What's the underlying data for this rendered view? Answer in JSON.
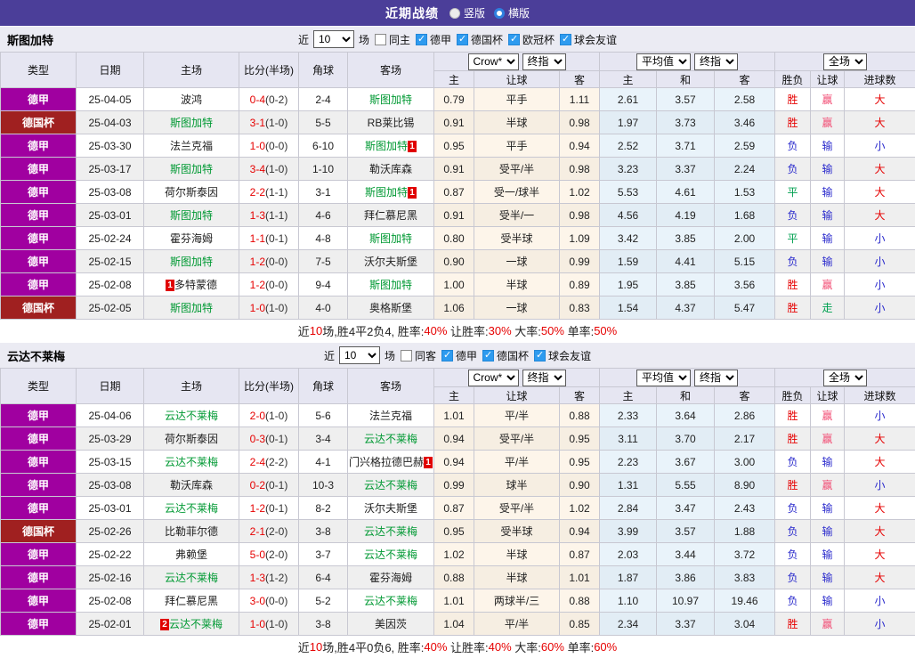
{
  "title_bar": {
    "title": "近期战绩",
    "radios": [
      {
        "label": "竖版",
        "selected": true
      },
      {
        "label": "横版",
        "selected": false
      }
    ]
  },
  "colors": {
    "title_bg": "#4B3E99",
    "team_highlight": "#009933",
    "score_red": "#E60000",
    "result_win_red": "#E60000",
    "result_cover_pink": "#F24D74",
    "result_lose_blue": "#2929CC",
    "result_draw_green": "#00A050",
    "handicap_col_bg": "#FDF5EA",
    "average_col_bg": "#E9F3FA",
    "header_bg": "#E6E6F2",
    "rank_badge_bg": "#E00000"
  },
  "league_colors": {
    "德甲": "#A000A0",
    "德国杯": "#A02020"
  },
  "table_header": {
    "main_cols": [
      "类型",
      "日期",
      "主场",
      "比分(半场)",
      "角球",
      "客场"
    ],
    "sub_cols": [
      "主",
      "让球",
      "客",
      "主",
      "和",
      "客",
      "胜负",
      "让球",
      "进球数"
    ],
    "selects": {
      "bookmaker": "Crow*",
      "odds_type_1": "终指",
      "average": "平均值",
      "odds_type_2": "终指",
      "scope": "全场"
    }
  },
  "sections": [
    {
      "team": "斯图加特",
      "filter": {
        "recent_label": "近",
        "count": "10",
        "matches_label": "场",
        "same_label": "同主",
        "same_checked": false,
        "leagues": [
          {
            "label": "德甲",
            "checked": true
          },
          {
            "label": "德国杯",
            "checked": true
          },
          {
            "label": "欧冠杯",
            "checked": true
          },
          {
            "label": "球会友谊",
            "checked": true
          }
        ]
      },
      "rows": [
        {
          "league": "德甲",
          "date": "25-04-05",
          "home": {
            "name": "波鸿"
          },
          "ft": "0-4",
          "ht": "0-2",
          "corner": "2-4",
          "away": {
            "name": "斯图加特",
            "green": true
          },
          "handicap": [
            "0.79",
            "平手",
            "1.11"
          ],
          "avg": [
            "2.61",
            "3.57",
            "2.58"
          ],
          "results": [
            [
              "胜",
              "r"
            ],
            [
              "赢",
              "p"
            ],
            [
              "大",
              "r"
            ]
          ]
        },
        {
          "league": "德国杯",
          "date": "25-04-03",
          "home": {
            "name": "斯图加特",
            "green": true
          },
          "ft": "3-1",
          "ht": "1-0",
          "corner": "5-5",
          "away": {
            "name": "RB莱比锡"
          },
          "handicap": [
            "0.91",
            "半球",
            "0.98"
          ],
          "avg": [
            "1.97",
            "3.73",
            "3.46"
          ],
          "results": [
            [
              "胜",
              "r"
            ],
            [
              "赢",
              "p"
            ],
            [
              "大",
              "r"
            ]
          ]
        },
        {
          "league": "德甲",
          "date": "25-03-30",
          "home": {
            "name": "法兰克福"
          },
          "ft": "1-0",
          "ht": "0-0",
          "corner": "6-10",
          "away": {
            "name": "斯图加特",
            "green": true,
            "rank": "1",
            "rank_pos": "after"
          },
          "handicap": [
            "0.95",
            "平手",
            "0.94"
          ],
          "avg": [
            "2.52",
            "3.71",
            "2.59"
          ],
          "results": [
            [
              "负",
              "b"
            ],
            [
              "输",
              "b"
            ],
            [
              "小",
              "b"
            ]
          ]
        },
        {
          "league": "德甲",
          "date": "25-03-17",
          "home": {
            "name": "斯图加特",
            "green": true
          },
          "ft": "3-4",
          "ht": "1-0",
          "corner": "1-10",
          "away": {
            "name": "勒沃库森"
          },
          "handicap": [
            "0.91",
            "受平/半",
            "0.98"
          ],
          "avg": [
            "3.23",
            "3.37",
            "2.24"
          ],
          "results": [
            [
              "负",
              "b"
            ],
            [
              "输",
              "b"
            ],
            [
              "大",
              "r"
            ]
          ]
        },
        {
          "league": "德甲",
          "date": "25-03-08",
          "home": {
            "name": "荷尔斯泰因"
          },
          "ft": "2-2",
          "ht": "1-1",
          "corner": "3-1",
          "away": {
            "name": "斯图加特",
            "green": true,
            "rank": "1",
            "rank_pos": "after"
          },
          "handicap": [
            "0.87",
            "受一/球半",
            "1.02"
          ],
          "avg": [
            "5.53",
            "4.61",
            "1.53"
          ],
          "results": [
            [
              "平",
              "g"
            ],
            [
              "输",
              "b"
            ],
            [
              "大",
              "r"
            ]
          ]
        },
        {
          "league": "德甲",
          "date": "25-03-01",
          "home": {
            "name": "斯图加特",
            "green": true
          },
          "ft": "1-3",
          "ht": "1-1",
          "corner": "4-6",
          "away": {
            "name": "拜仁慕尼黑"
          },
          "handicap": [
            "0.91",
            "受半/一",
            "0.98"
          ],
          "avg": [
            "4.56",
            "4.19",
            "1.68"
          ],
          "results": [
            [
              "负",
              "b"
            ],
            [
              "输",
              "b"
            ],
            [
              "大",
              "r"
            ]
          ]
        },
        {
          "league": "德甲",
          "date": "25-02-24",
          "home": {
            "name": "霍芬海姆"
          },
          "ft": "1-1",
          "ht": "0-1",
          "corner": "4-8",
          "away": {
            "name": "斯图加特",
            "green": true
          },
          "handicap": [
            "0.80",
            "受半球",
            "1.09"
          ],
          "avg": [
            "3.42",
            "3.85",
            "2.00"
          ],
          "results": [
            [
              "平",
              "g"
            ],
            [
              "输",
              "b"
            ],
            [
              "小",
              "b"
            ]
          ]
        },
        {
          "league": "德甲",
          "date": "25-02-15",
          "home": {
            "name": "斯图加特",
            "green": true
          },
          "ft": "1-2",
          "ht": "0-0",
          "corner": "7-5",
          "away": {
            "name": "沃尔夫斯堡"
          },
          "handicap": [
            "0.90",
            "一球",
            "0.99"
          ],
          "avg": [
            "1.59",
            "4.41",
            "5.15"
          ],
          "results": [
            [
              "负",
              "b"
            ],
            [
              "输",
              "b"
            ],
            [
              "小",
              "b"
            ]
          ]
        },
        {
          "league": "德甲",
          "date": "25-02-08",
          "home": {
            "name": "多特蒙德",
            "rank": "1",
            "rank_pos": "before"
          },
          "ft": "1-2",
          "ht": "0-0",
          "corner": "9-4",
          "away": {
            "name": "斯图加特",
            "green": true
          },
          "handicap": [
            "1.00",
            "半球",
            "0.89"
          ],
          "avg": [
            "1.95",
            "3.85",
            "3.56"
          ],
          "results": [
            [
              "胜",
              "r"
            ],
            [
              "赢",
              "p"
            ],
            [
              "小",
              "b"
            ]
          ]
        },
        {
          "league": "德国杯",
          "date": "25-02-05",
          "home": {
            "name": "斯图加特",
            "green": true
          },
          "ft": "1-0",
          "ht": "1-0",
          "corner": "4-0",
          "away": {
            "name": "奥格斯堡"
          },
          "handicap": [
            "1.06",
            "一球",
            "0.83"
          ],
          "avg": [
            "1.54",
            "4.37",
            "5.47"
          ],
          "results": [
            [
              "胜",
              "r"
            ],
            [
              "走",
              "g"
            ],
            [
              "小",
              "b"
            ]
          ]
        }
      ],
      "summary": [
        [
          "近",
          "k"
        ],
        [
          "10",
          "r"
        ],
        [
          "场,胜4平2负4, 胜率:",
          "k"
        ],
        [
          "40%",
          "r"
        ],
        [
          " 让胜率:",
          "k"
        ],
        [
          "30%",
          "r"
        ],
        [
          " 大率:",
          "k"
        ],
        [
          "50%",
          "r"
        ],
        [
          " 单率:",
          "k"
        ],
        [
          "50%",
          "r"
        ]
      ]
    },
    {
      "team": "云达不莱梅",
      "filter": {
        "recent_label": "近",
        "count": "10",
        "matches_label": "场",
        "same_label": "同客",
        "same_checked": false,
        "leagues": [
          {
            "label": "德甲",
            "checked": true
          },
          {
            "label": "德国杯",
            "checked": true
          },
          {
            "label": "球会友谊",
            "checked": true
          }
        ]
      },
      "rows": [
        {
          "league": "德甲",
          "date": "25-04-06",
          "home": {
            "name": "云达不莱梅",
            "green": true
          },
          "ft": "2-0",
          "ht": "1-0",
          "corner": "5-6",
          "away": {
            "name": "法兰克福"
          },
          "handicap": [
            "1.01",
            "平/半",
            "0.88"
          ],
          "avg": [
            "2.33",
            "3.64",
            "2.86"
          ],
          "results": [
            [
              "胜",
              "r"
            ],
            [
              "赢",
              "p"
            ],
            [
              "小",
              "b"
            ]
          ]
        },
        {
          "league": "德甲",
          "date": "25-03-29",
          "home": {
            "name": "荷尔斯泰因"
          },
          "ft": "0-3",
          "ht": "0-1",
          "corner": "3-4",
          "away": {
            "name": "云达不莱梅",
            "green": true
          },
          "handicap": [
            "0.94",
            "受平/半",
            "0.95"
          ],
          "avg": [
            "3.11",
            "3.70",
            "2.17"
          ],
          "results": [
            [
              "胜",
              "r"
            ],
            [
              "赢",
              "p"
            ],
            [
              "大",
              "r"
            ]
          ]
        },
        {
          "league": "德甲",
          "date": "25-03-15",
          "home": {
            "name": "云达不莱梅",
            "green": true
          },
          "ft": "2-4",
          "ht": "2-2",
          "corner": "4-1",
          "away": {
            "name": "门兴格拉德巴赫",
            "rank": "1",
            "rank_pos": "after"
          },
          "handicap": [
            "0.94",
            "平/半",
            "0.95"
          ],
          "avg": [
            "2.23",
            "3.67",
            "3.00"
          ],
          "results": [
            [
              "负",
              "b"
            ],
            [
              "输",
              "b"
            ],
            [
              "大",
              "r"
            ]
          ]
        },
        {
          "league": "德甲",
          "date": "25-03-08",
          "home": {
            "name": "勒沃库森"
          },
          "ft": "0-2",
          "ht": "0-1",
          "corner": "10-3",
          "away": {
            "name": "云达不莱梅",
            "green": true
          },
          "handicap": [
            "0.99",
            "球半",
            "0.90"
          ],
          "avg": [
            "1.31",
            "5.55",
            "8.90"
          ],
          "results": [
            [
              "胜",
              "r"
            ],
            [
              "赢",
              "p"
            ],
            [
              "小",
              "b"
            ]
          ]
        },
        {
          "league": "德甲",
          "date": "25-03-01",
          "home": {
            "name": "云达不莱梅",
            "green": true
          },
          "ft": "1-2",
          "ht": "0-1",
          "corner": "8-2",
          "away": {
            "name": "沃尔夫斯堡"
          },
          "handicap": [
            "0.87",
            "受平/半",
            "1.02"
          ],
          "avg": [
            "2.84",
            "3.47",
            "2.43"
          ],
          "results": [
            [
              "负",
              "b"
            ],
            [
              "输",
              "b"
            ],
            [
              "大",
              "r"
            ]
          ]
        },
        {
          "league": "德国杯",
          "date": "25-02-26",
          "home": {
            "name": "比勒菲尔德"
          },
          "ft": "2-1",
          "ht": "2-0",
          "corner": "3-8",
          "away": {
            "name": "云达不莱梅",
            "green": true
          },
          "handicap": [
            "0.95",
            "受半球",
            "0.94"
          ],
          "avg": [
            "3.99",
            "3.57",
            "1.88"
          ],
          "results": [
            [
              "负",
              "b"
            ],
            [
              "输",
              "b"
            ],
            [
              "大",
              "r"
            ]
          ]
        },
        {
          "league": "德甲",
          "date": "25-02-22",
          "home": {
            "name": "弗赖堡"
          },
          "ft": "5-0",
          "ht": "2-0",
          "corner": "3-7",
          "away": {
            "name": "云达不莱梅",
            "green": true
          },
          "handicap": [
            "1.02",
            "半球",
            "0.87"
          ],
          "avg": [
            "2.03",
            "3.44",
            "3.72"
          ],
          "results": [
            [
              "负",
              "b"
            ],
            [
              "输",
              "b"
            ],
            [
              "大",
              "r"
            ]
          ]
        },
        {
          "league": "德甲",
          "date": "25-02-16",
          "home": {
            "name": "云达不莱梅",
            "green": true
          },
          "ft": "1-3",
          "ht": "1-2",
          "corner": "6-4",
          "away": {
            "name": "霍芬海姆"
          },
          "handicap": [
            "0.88",
            "半球",
            "1.01"
          ],
          "avg": [
            "1.87",
            "3.86",
            "3.83"
          ],
          "results": [
            [
              "负",
              "b"
            ],
            [
              "输",
              "b"
            ],
            [
              "大",
              "r"
            ]
          ]
        },
        {
          "league": "德甲",
          "date": "25-02-08",
          "home": {
            "name": "拜仁慕尼黑"
          },
          "ft": "3-0",
          "ht": "0-0",
          "corner": "5-2",
          "away": {
            "name": "云达不莱梅",
            "green": true
          },
          "handicap": [
            "1.01",
            "两球半/三",
            "0.88"
          ],
          "avg": [
            "1.10",
            "10.97",
            "19.46"
          ],
          "results": [
            [
              "负",
              "b"
            ],
            [
              "输",
              "b"
            ],
            [
              "小",
              "b"
            ]
          ]
        },
        {
          "league": "德甲",
          "date": "25-02-01",
          "home": {
            "name": "云达不莱梅",
            "green": true,
            "rank": "2",
            "rank_pos": "before"
          },
          "ft": "1-0",
          "ht": "1-0",
          "corner": "3-8",
          "away": {
            "name": "美因茨"
          },
          "handicap": [
            "1.04",
            "平/半",
            "0.85"
          ],
          "avg": [
            "2.34",
            "3.37",
            "3.04"
          ],
          "results": [
            [
              "胜",
              "r"
            ],
            [
              "赢",
              "p"
            ],
            [
              "小",
              "b"
            ]
          ]
        }
      ],
      "summary": [
        [
          "近",
          "k"
        ],
        [
          "10",
          "r"
        ],
        [
          "场,胜4平0负6, 胜率:",
          "k"
        ],
        [
          "40%",
          "r"
        ],
        [
          " 让胜率:",
          "k"
        ],
        [
          "40%",
          "r"
        ],
        [
          " 大率:",
          "k"
        ],
        [
          "60%",
          "r"
        ],
        [
          " 单率:",
          "k"
        ],
        [
          "60%",
          "r"
        ]
      ]
    }
  ]
}
